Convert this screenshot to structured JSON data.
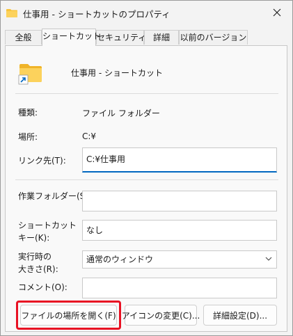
{
  "window": {
    "title": "仕事用 - ショートカットのプロパティ"
  },
  "tabs": [
    {
      "label": "全般",
      "active": false
    },
    {
      "label": "ショートカット",
      "active": true
    },
    {
      "label": "セキュリティ",
      "active": false
    },
    {
      "label": "詳細",
      "active": false
    },
    {
      "label": "以前のバージョン",
      "active": false
    }
  ],
  "header": {
    "name": "仕事用 - ショートカット"
  },
  "info": {
    "type_label": "種類:",
    "type_value": "ファイル フォルダー",
    "location_label": "場所:",
    "location_value": "C:¥",
    "target_label": "リンク先(T):",
    "target_value": "C:¥仕事用"
  },
  "form": {
    "start_in_label": "作業フォルダー(S):",
    "start_in_value": "",
    "shortcut_key_label_1": "ショートカット",
    "shortcut_key_label_2": "キー(K):",
    "shortcut_key_value": "なし",
    "run_label_1": "実行時の",
    "run_label_2": "大きさ(R):",
    "run_value": "通常のウィンドウ",
    "comment_label": "コメント(O):",
    "comment_value": ""
  },
  "buttons": {
    "open_location": "ファイルの場所を開く(F)",
    "change_icon": "アイコンの変更(C)...",
    "advanced": "詳細設定(D)..."
  },
  "colors": {
    "accent": "#0067c0",
    "highlight": "#e81123",
    "folder": "#f8c43b"
  }
}
